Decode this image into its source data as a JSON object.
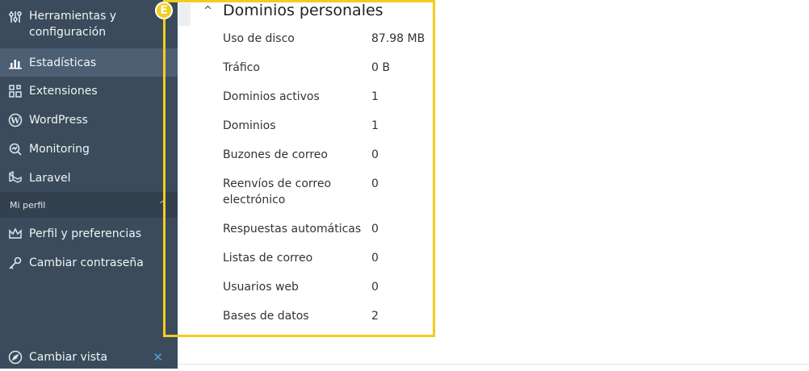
{
  "sidebar": {
    "items": [
      {
        "label": "Herramientas y configuración",
        "icon": "sliders-icon"
      },
      {
        "label": "Estadísticas",
        "icon": "bar-chart-icon"
      },
      {
        "label": "Extensiones",
        "icon": "extensions-icon"
      },
      {
        "label": "WordPress",
        "icon": "wordpress-icon"
      },
      {
        "label": "Monitoring",
        "icon": "monitoring-icon"
      },
      {
        "label": "Laravel",
        "icon": "laravel-icon"
      }
    ],
    "profile_section": "Mi perfil",
    "profile_items": [
      {
        "label": "Perfil y preferencias",
        "icon": "crown-icon"
      },
      {
        "label": "Cambiar contraseña",
        "icon": "key-icon"
      }
    ],
    "footer_item": {
      "label": "Cambiar vista",
      "icon": "compass-icon"
    }
  },
  "panel": {
    "badge": "E",
    "title": "Dominios personales",
    "rows": [
      {
        "label": "Uso de disco",
        "value": "87.98 MB"
      },
      {
        "label": "Tráfico",
        "value": "0 B"
      },
      {
        "label": "Dominios activos",
        "value": "1"
      },
      {
        "label": "Dominios",
        "value": "1"
      },
      {
        "label": "Buzones de correo",
        "value": "0"
      },
      {
        "label": "Reenvíos de correo electrónico",
        "value": "0"
      },
      {
        "label": "Respuestas automáticas",
        "value": "0"
      },
      {
        "label": "Listas de correo",
        "value": "0"
      },
      {
        "label": "Usuarios web",
        "value": "0"
      },
      {
        "label": "Bases de datos",
        "value": "2"
      }
    ]
  },
  "colors": {
    "sidebar_bg": "#3b4b5b",
    "active_bg": "#4c5f73",
    "highlight": "#f2cd1e",
    "accent": "#4aa3df"
  }
}
